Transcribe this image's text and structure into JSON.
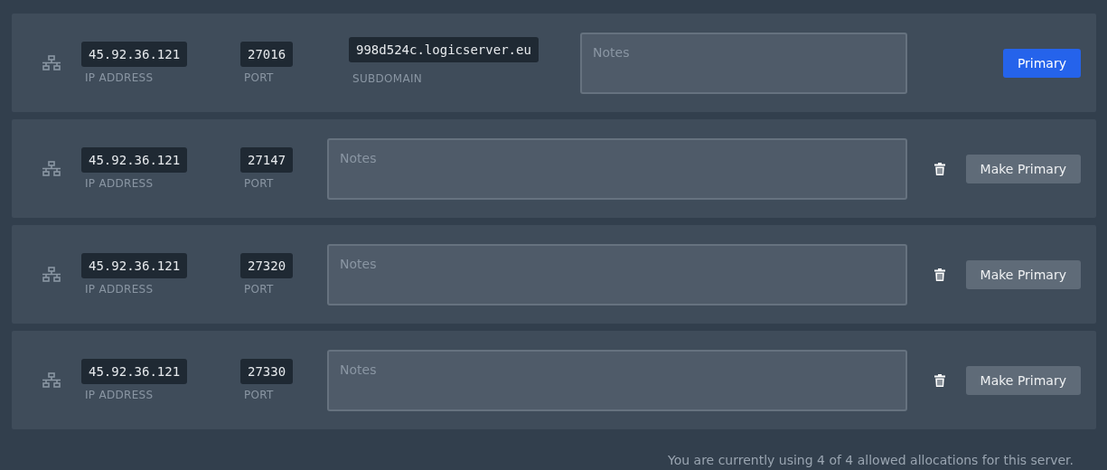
{
  "allocations": [
    {
      "ip": "45.92.36.121",
      "ip_label": "IP ADDRESS",
      "port": "27016",
      "port_label": "PORT",
      "subdomain": "998d524c.logicserver.eu",
      "subdomain_label": "SUBDOMAIN",
      "notes_placeholder": "Notes",
      "primary": true,
      "button": "Primary"
    },
    {
      "ip": "45.92.36.121",
      "ip_label": "IP ADDRESS",
      "port": "27147",
      "port_label": "PORT",
      "notes_placeholder": "Notes",
      "primary": false,
      "button": "Make Primary"
    },
    {
      "ip": "45.92.36.121",
      "ip_label": "IP ADDRESS",
      "port": "27320",
      "port_label": "PORT",
      "notes_placeholder": "Notes",
      "primary": false,
      "button": "Make Primary"
    },
    {
      "ip": "45.92.36.121",
      "ip_label": "IP ADDRESS",
      "port": "27330",
      "port_label": "PORT",
      "notes_placeholder": "Notes",
      "primary": false,
      "button": "Make Primary"
    }
  ],
  "footer": "You are currently using 4 of 4 allowed allocations for this server."
}
